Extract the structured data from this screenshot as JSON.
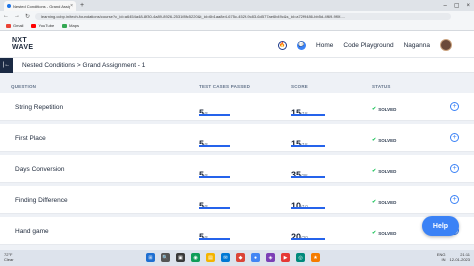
{
  "browser": {
    "tab_title": "Nested Conditions - Grand Assignment - 1",
    "tab_close": "×",
    "new_tab": "+",
    "window_controls": [
      "–",
      "▢",
      "×"
    ],
    "url": "learning.ccbp.in/tech-foundations/course?c_id=a6454a48-8f30-4a89-8926-2531f8fc5220&t_id=6b1aa8e4-675c-452f-9c83-6d577ae6b49c&s_id=a72f9486-bb5d-4f69-9f0f-...",
    "nav": [
      "←",
      "→",
      "↻"
    ],
    "bookmarks": [
      {
        "label": "Gmail",
        "color": "#ea4335"
      },
      {
        "label": "YouTube",
        "color": "#ff0000"
      },
      {
        "label": "Maps",
        "color": "#34a853"
      }
    ]
  },
  "header": {
    "logo_line1": "NXT",
    "logo_line2": "WAVE",
    "home": "Home",
    "code_playground": "Code Playground",
    "user_name": "Naganna",
    "streak_icon": "🔥",
    "chat_icon": "💬"
  },
  "breadcrumb": {
    "menu_icon": "|←",
    "text": "Nested Conditions > Grand Assignment - 1"
  },
  "table": {
    "headers": {
      "question": "QUESTION",
      "test_cases": "TEST CASES PASSED",
      "score": "SCORE",
      "status": "STATUS"
    },
    "rows": [
      {
        "name": "String Repetition",
        "tc_passed": "5",
        "tc_total": "/5",
        "tc_fraction": 1.0,
        "score": "15",
        "score_total": "/15",
        "score_fraction": 1.0,
        "status": "SOLVED",
        "status_icon": "✔",
        "expand_icon": "+"
      },
      {
        "name": "First Place",
        "tc_passed": "5",
        "tc_total": "/5",
        "tc_fraction": 1.0,
        "score": "15",
        "score_total": "/15",
        "score_fraction": 1.0,
        "status": "SOLVED",
        "status_icon": "✔",
        "expand_icon": "+"
      },
      {
        "name": "Days Conversion",
        "tc_passed": "5",
        "tc_total": "/5",
        "tc_fraction": 1.0,
        "score": "35",
        "score_total": "/35",
        "score_fraction": 1.0,
        "status": "SOLVED",
        "status_icon": "✔",
        "expand_icon": "+"
      },
      {
        "name": "Finding Difference",
        "tc_passed": "5",
        "tc_total": "/5",
        "tc_fraction": 1.0,
        "score": "10",
        "score_total": "/10",
        "score_fraction": 1.0,
        "status": "SOLVED",
        "status_icon": "✔",
        "expand_icon": "+"
      },
      {
        "name": "Hand game",
        "tc_passed": "5",
        "tc_total": "/5",
        "tc_fraction": 1.0,
        "score": "20",
        "score_total": "/20",
        "score_fraction": 1.0,
        "status": "SOLVED",
        "status_icon": "✔",
        "expand_icon": "+"
      }
    ]
  },
  "help_button": "Help",
  "taskbar": {
    "weather_temp": "72°F",
    "weather_desc": "Clear",
    "apps": [
      {
        "icon": "⊞",
        "color": "#1f6fd1"
      },
      {
        "icon": "🔍",
        "color": "#555555"
      },
      {
        "icon": "▣",
        "color": "#3a3a3a"
      },
      {
        "icon": "◉",
        "color": "#0f9d58"
      },
      {
        "icon": "▤",
        "color": "#f4b400"
      },
      {
        "icon": "✉",
        "color": "#0078d4"
      },
      {
        "icon": "◆",
        "color": "#db4437"
      },
      {
        "icon": "●",
        "color": "#4285f4"
      },
      {
        "icon": "◈",
        "color": "#7b3fb5"
      },
      {
        "icon": "▶",
        "color": "#e53935"
      },
      {
        "icon": "◎",
        "color": "#00897b"
      },
      {
        "icon": "★",
        "color": "#f57c00"
      }
    ],
    "language": "ENG",
    "region": "IN",
    "time": "21:11",
    "date": "12-01-2023"
  }
}
